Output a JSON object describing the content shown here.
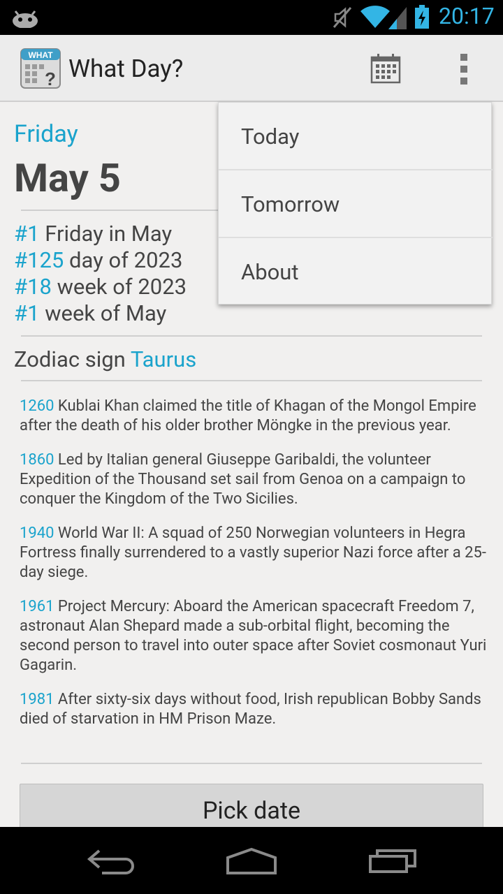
{
  "status_bar": {
    "time": "20:17",
    "icons": [
      "android-icon",
      "mute-icon",
      "wifi-icon",
      "signal-icon",
      "battery-charging-icon"
    ]
  },
  "action_bar": {
    "title": "What Day?",
    "icon_text": "WHAT",
    "icons": [
      "app-logo-icon",
      "calendar-icon",
      "overflow-menu-icon"
    ]
  },
  "day": {
    "weekday": "Friday",
    "date": "May 5"
  },
  "stats": [
    {
      "num": "#1",
      "text": " Friday in May"
    },
    {
      "num": "#125",
      "text": " day of 2023"
    },
    {
      "num": "#18",
      "text": " week of 2023"
    },
    {
      "num": "#1",
      "text": " week of May"
    }
  ],
  "zodiac": {
    "label": "Zodiac sign ",
    "sign": "Taurus"
  },
  "events": [
    {
      "year": "1260",
      "text": " Kublai Khan claimed the title of Khagan of the Mongol Empire after the death of his older brother Möngke in the previous year."
    },
    {
      "year": "1860",
      "text": " Led by Italian general Giuseppe Garibaldi, the volunteer Expedition of the Thousand set sail from Genoa on a campaign to conquer the Kingdom of the Two Sicilies."
    },
    {
      "year": "1940",
      "text": " World War II: A squad of 250 Norwegian volunteers in Hegra Fortress finally surrendered to a vastly superior Nazi force after a 25-day siege."
    },
    {
      "year": "1961",
      "text": " Project Mercury: Aboard the American spacecraft Freedom 7, astronaut Alan Shepard made a sub-orbital flight, becoming the second person to travel into outer space after Soviet cosmonaut Yuri Gagarin."
    },
    {
      "year": "1981",
      "text": " After sixty-six days without food, Irish republican Bobby Sands died of starvation in HM Prison Maze."
    }
  ],
  "pick_date_label": "Pick date",
  "menu": {
    "items": [
      "Today",
      "Tomorrow",
      "About"
    ]
  },
  "nav_bar": {
    "icons": [
      "back-icon",
      "home-icon",
      "recent-apps-icon"
    ]
  },
  "colors": {
    "accent": "#1aa3cc",
    "status_clock": "#33b5e5",
    "background": "#f1f0ef"
  }
}
